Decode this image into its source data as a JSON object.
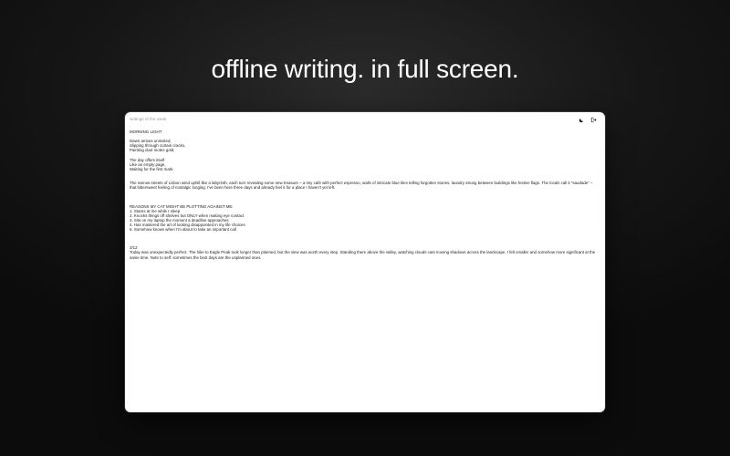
{
  "hero": {
    "title": "offline writing. in full screen."
  },
  "window": {
    "doc_title": "writings of the week",
    "theme_toggle_icon": "moon-icon",
    "exit_icon": "exit-fullscreen-icon"
  },
  "editor": {
    "lines": [
      "MORNING LIGHT",
      "",
      "Dawn arrives uninvited,",
      "Slipping through curtain cracks,",
      "Painting dust motes gold.",
      "",
      "The day offers itself",
      "Like an empty page,",
      "Waiting for the first mark.",
      "",
      "",
      "The narrow streets of Lisbon wind uphill like a labyrinth, each turn revealing some new treasure – a tiny café with perfect espresso, walls of intricate blue tiles telling forgotten stories, laundry strung between buildings like festive flags. The locals call it \"saudade\" – that bittersweet feeling of nostalgic longing. I've been here three days and already feel it for a place I haven't yet left.",
      "",
      "",
      "",
      "REASONS MY CAT MIGHT BE PLOTTING AGAINST ME:",
      "1. Stares at me while I sleep",
      "2. Knocks things off shelves but ONLY when making eye contact",
      "3. Sits on my laptop the moment a deadline approaches",
      "4. Has mastered the art of looking disappointed in my life choices",
      "5. Somehow knows when I'm about to take an important call",
      "",
      "",
      "",
      "3/12",
      "Today was unexpectedly perfect. The hike to Eagle Peak took longer than planned, but the view was worth every step. Standing there above the valley, watching clouds cast moving shadows across the landscape, I felt smaller and somehow more significant at the same time. Note to self: sometimes the best days are the unplanned ones."
    ]
  }
}
